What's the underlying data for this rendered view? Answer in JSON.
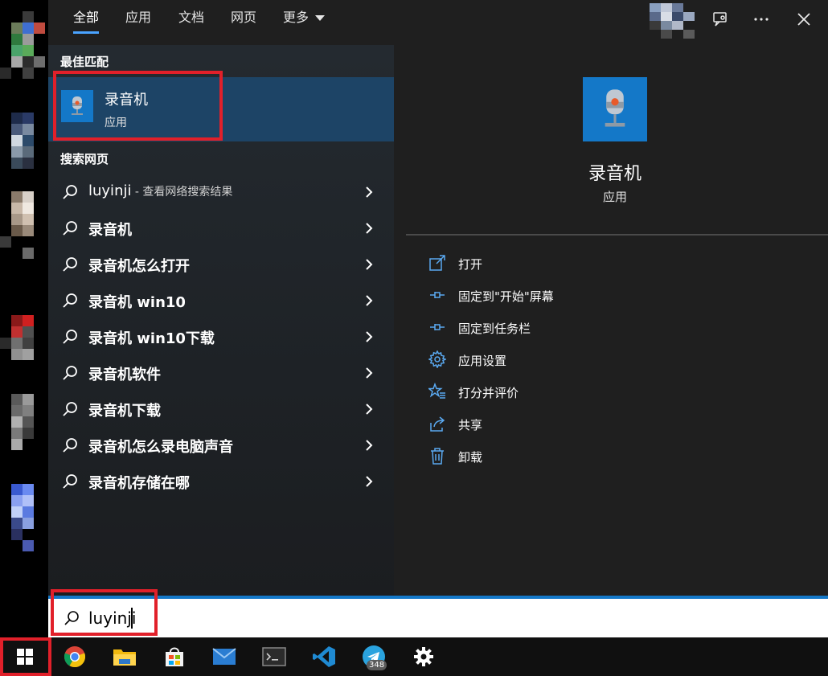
{
  "tabs": [
    {
      "label": "全部",
      "active": true
    },
    {
      "label": "应用",
      "active": false
    },
    {
      "label": "文档",
      "active": false
    },
    {
      "label": "网页",
      "active": false
    },
    {
      "label": "更多",
      "active": false
    }
  ],
  "sections": {
    "best_match": "最佳匹配",
    "search_web": "搜索网页"
  },
  "best_match": {
    "title": "录音机",
    "subtitle": "应用",
    "icon": "microphone-icon"
  },
  "web_results": [
    {
      "query": "luyinji",
      "hint": " - 查看网络搜索结果"
    },
    {
      "query": "录音机"
    },
    {
      "query": "录音机怎么打开"
    },
    {
      "query": "录音机 win10"
    },
    {
      "query": "录音机 win10下载"
    },
    {
      "query": "录音机软件"
    },
    {
      "query": "录音机下载"
    },
    {
      "query": "录音机怎么录电脑声音"
    },
    {
      "query": "录音机存储在哪"
    }
  ],
  "preview": {
    "title": "录音机",
    "subtitle": "应用",
    "actions": [
      {
        "label": "打开",
        "icon": "open-icon"
      },
      {
        "label": "固定到\"开始\"屏幕",
        "icon": "pin-icon"
      },
      {
        "label": "固定到任务栏",
        "icon": "pin-icon"
      },
      {
        "label": "应用设置",
        "icon": "gear-icon"
      },
      {
        "label": "打分并评价",
        "icon": "star-icon"
      },
      {
        "label": "共享",
        "icon": "share-icon"
      },
      {
        "label": "卸载",
        "icon": "trash-icon"
      }
    ]
  },
  "search": {
    "value": "luyinji"
  },
  "taskbar": {
    "items": [
      "start-icon",
      "chrome-icon",
      "file-explorer-icon",
      "store-icon",
      "mail-icon",
      "terminal-icon",
      "vscode-icon",
      "telegram-icon",
      "settings-icon"
    ],
    "telegram_badge": "348"
  },
  "colors": {
    "accent": "#1478c8",
    "highlight_box": "#e1202a",
    "selected_row": "#1d4466"
  }
}
